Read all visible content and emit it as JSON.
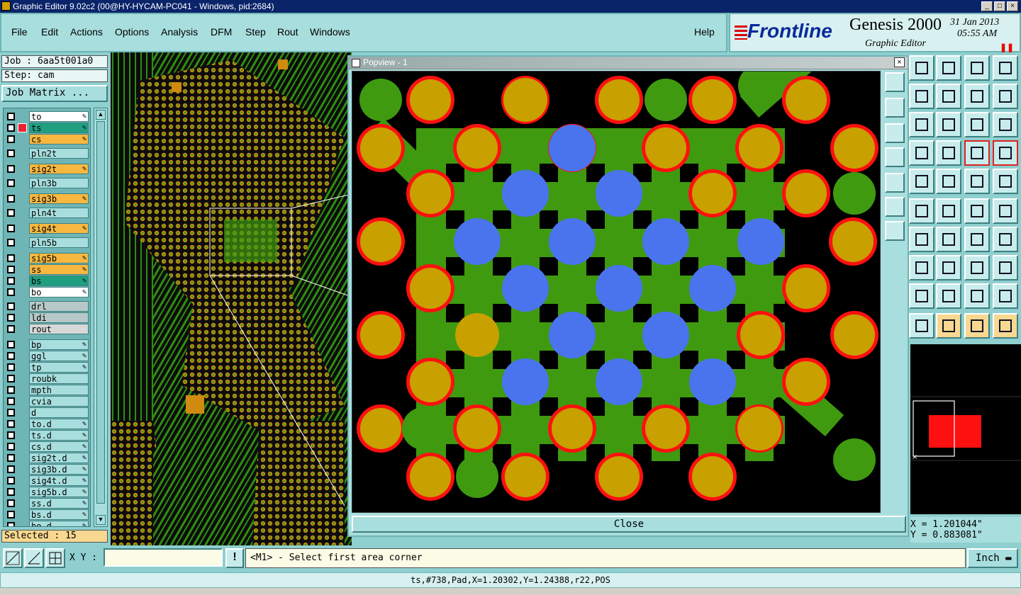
{
  "window": {
    "title": "Graphic Editor 9.02c2 (00@HY-HYCAM-PC041 - Windows, pid:2684)"
  },
  "menu": [
    "File",
    "Edit",
    "Actions",
    "Options",
    "Analysis",
    "DFM",
    "Step",
    "Rout",
    "Windows"
  ],
  "help_label": "Help",
  "brand": {
    "logo": "Frontline",
    "product": "Genesis 2000",
    "subtitle": "Graphic Editor",
    "date": "31 Jan 2013",
    "time": "05:55 AM",
    "pause_icon": "pause-icon"
  },
  "job": {
    "job_label": "Job : 6aa5t001a0",
    "step_label": "Step: cam",
    "matrix_button": "Job Matrix ..."
  },
  "layers": [
    {
      "name": "to",
      "color": "#ffffff",
      "editable": true
    },
    {
      "name": "ts",
      "color": "#1f9f7f",
      "editable": true,
      "active": true
    },
    {
      "name": "cs",
      "color": "#f8b840",
      "editable": true
    },
    {
      "name": "pln2t",
      "color": "#a8dede",
      "editable": false
    },
    {
      "name": "sig2t",
      "color": "#f8b840",
      "editable": true
    },
    {
      "name": "pln3b",
      "color": "#a8dede",
      "editable": false
    },
    {
      "name": "sig3b",
      "color": "#f8b840",
      "editable": true
    },
    {
      "name": "pln4t",
      "color": "#a8dede",
      "editable": false
    },
    {
      "name": "sig4t",
      "color": "#f8b840",
      "editable": true
    },
    {
      "name": "pln5b",
      "color": "#a8dede",
      "editable": false
    },
    {
      "name": "sig5b",
      "color": "#f8b840",
      "editable": true
    },
    {
      "name": "ss",
      "color": "#f8b840",
      "editable": true
    },
    {
      "name": "bs",
      "color": "#1f9f7f",
      "editable": true
    },
    {
      "name": "bo",
      "color": "#ffffff",
      "editable": true
    },
    {
      "name": "drl",
      "color": "#b8c8c8",
      "editable": false
    },
    {
      "name": "ldi",
      "color": "#b8c8c8",
      "editable": false
    },
    {
      "name": "rout",
      "color": "#d8d8d8",
      "editable": false
    },
    {
      "name": "bp",
      "color": "#a8dede",
      "editable": true
    },
    {
      "name": "ggl",
      "color": "#a8dede",
      "editable": true
    },
    {
      "name": "tp",
      "color": "#a8dede",
      "editable": true
    },
    {
      "name": "roubk",
      "color": "#a8dede",
      "editable": false
    },
    {
      "name": "mpth",
      "color": "#a8dede",
      "editable": false
    },
    {
      "name": "cvia",
      "color": "#a8dede",
      "editable": false
    },
    {
      "name": "d",
      "color": "#a8dede",
      "editable": false
    },
    {
      "name": "to.d",
      "color": "#a8dede",
      "editable": true
    },
    {
      "name": "ts.d",
      "color": "#a8dede",
      "editable": true
    },
    {
      "name": "cs.d",
      "color": "#a8dede",
      "editable": true
    },
    {
      "name": "sig2t.d",
      "color": "#a8dede",
      "editable": true
    },
    {
      "name": "sig3b.d",
      "color": "#a8dede",
      "editable": true
    },
    {
      "name": "sig4t.d",
      "color": "#a8dede",
      "editable": true
    },
    {
      "name": "sig5b.d",
      "color": "#a8dede",
      "editable": true
    },
    {
      "name": "ss.d",
      "color": "#a8dede",
      "editable": true
    },
    {
      "name": "bs.d",
      "color": "#a8dede",
      "editable": true
    },
    {
      "name": "bo.d",
      "color": "#a8dede",
      "editable": true
    }
  ],
  "selected_label": "Selected : 15",
  "popview": {
    "title": "Popview - 1",
    "close_label": "Close"
  },
  "coords": {
    "x": "X = 1.201044\"",
    "y": "Y = 0.883081\""
  },
  "input": {
    "xy_label": "X Y :",
    "xy_value": "",
    "prompt": "<M1> - Select first area corner",
    "units": "Inch"
  },
  "status": "ts,#738,Pad,X=1.20302,Y=1.24388,r22,POS",
  "colors": {
    "pad_red": "#ff1010",
    "pad_gold": "#c8a000",
    "copper_green": "#3f9a10",
    "via_blue": "#4a74ee",
    "panel": "#a8dede"
  }
}
